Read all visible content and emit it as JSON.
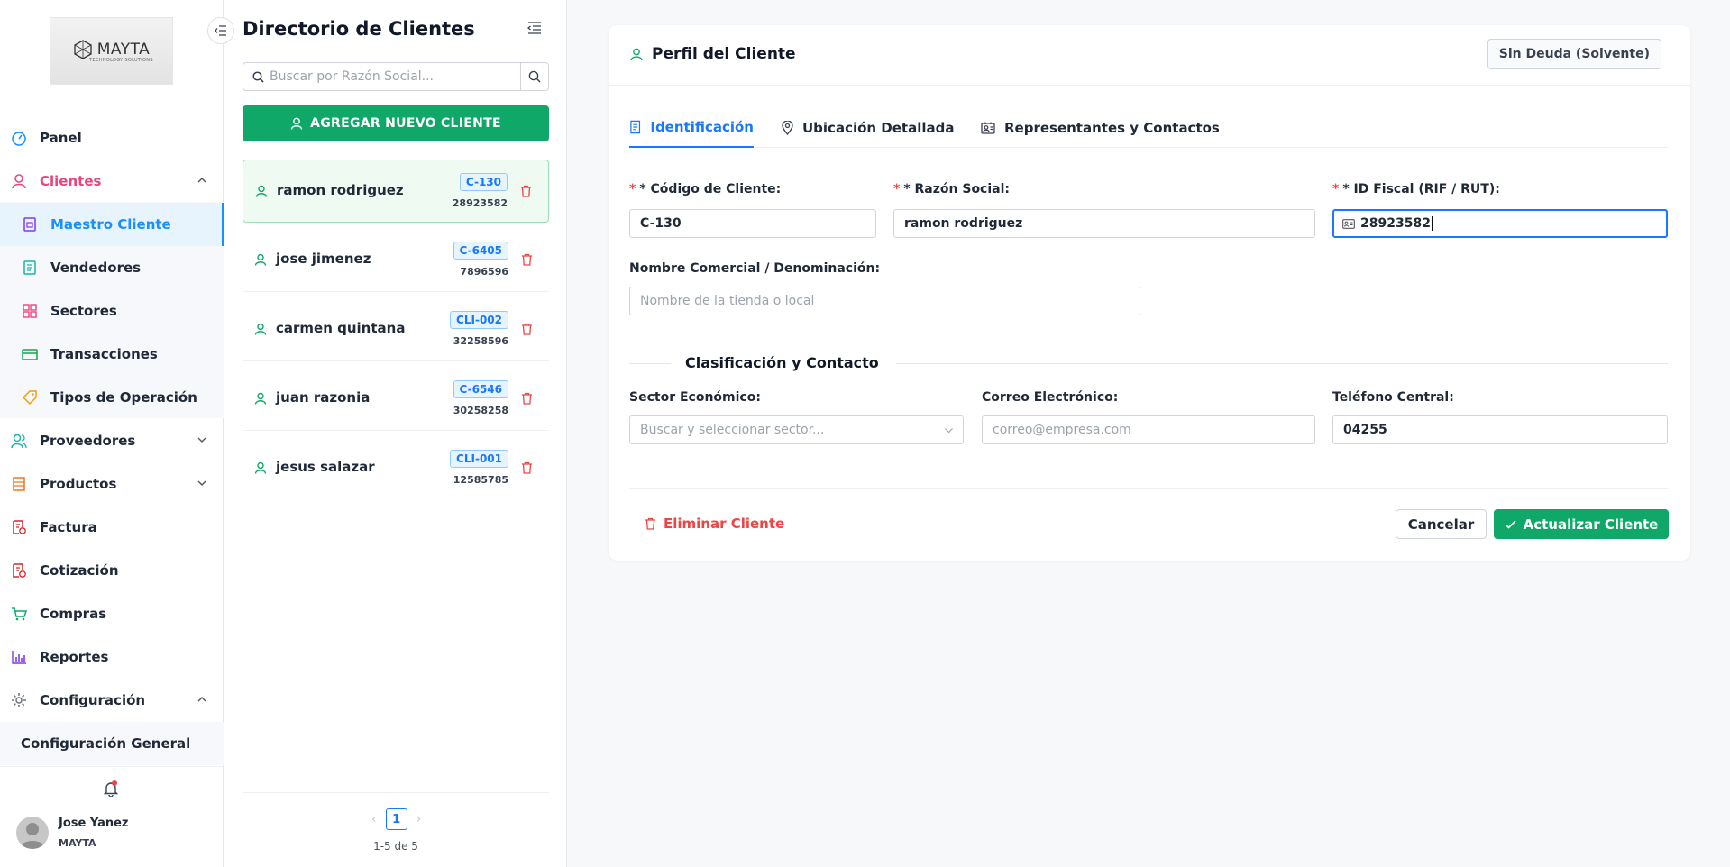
{
  "brand": {
    "name": "MAYTA",
    "tagline": "TECHNOLOGY SOLUTIONS"
  },
  "sidebar": {
    "items": [
      {
        "label": "Panel"
      },
      {
        "label": "Clientes"
      },
      {
        "label": "Maestro Cliente"
      },
      {
        "label": "Vendedores"
      },
      {
        "label": "Sectores"
      },
      {
        "label": "Transacciones"
      },
      {
        "label": "Tipos de Operación"
      },
      {
        "label": "Proveedores"
      },
      {
        "label": "Productos"
      },
      {
        "label": "Factura"
      },
      {
        "label": "Cotización"
      },
      {
        "label": "Compras"
      },
      {
        "label": "Reportes"
      },
      {
        "label": "Configuración"
      },
      {
        "label": "Configuración General"
      }
    ],
    "user": {
      "name": "Jose Yanez",
      "org": "MAYTA"
    }
  },
  "directory": {
    "title": "Directorio de Clientes",
    "search_placeholder": "Buscar por Razón Social...",
    "add_label": "AGREGAR NUEVO CLIENTE",
    "clients": [
      {
        "name": "ramon rodriguez",
        "code": "C-130",
        "id": "28923582"
      },
      {
        "name": "jose jimenez",
        "code": "C-6405",
        "id": "7896596"
      },
      {
        "name": "carmen quintana",
        "code": "CLI-002",
        "id": "32258596"
      },
      {
        "name": "juan razonia",
        "code": "C-6546",
        "id": "30258258"
      },
      {
        "name": "jesus salazar",
        "code": "CLI-001",
        "id": "12585785"
      }
    ],
    "page": "1",
    "range": "1-5 de 5"
  },
  "profile": {
    "title": "Perfil del Cliente",
    "status": "Sin Deuda (Solvente)",
    "tabs": [
      "Identificación",
      "Ubicación Detallada",
      "Representantes y Contactos"
    ],
    "fields": {
      "code_label": "* Código de Cliente:",
      "code_value": "C-130",
      "razon_label": "* Razón Social:",
      "razon_value": "ramon rodriguez",
      "fiscal_label": "* ID Fiscal (RIF / RUT):",
      "fiscal_value": "28923582",
      "comercial_label": "Nombre Comercial / Denominación:",
      "comercial_placeholder": "Nombre de la tienda o local"
    },
    "section_title": "Clasificación y Contacto",
    "contact": {
      "sector_label": "Sector Económico:",
      "sector_placeholder": "Buscar y seleccionar sector...",
      "email_label": "Correo Electrónico:",
      "email_placeholder": "correo@empresa.com",
      "phone_label": "Teléfono Central:",
      "phone_value": "04255"
    },
    "actions": {
      "delete": "Eliminar Cliente",
      "cancel": "Cancelar",
      "update": "Actualizar Cliente"
    }
  },
  "colors": {
    "primary": "#1677ff",
    "success": "#0fa868",
    "danger": "#ef4444"
  }
}
